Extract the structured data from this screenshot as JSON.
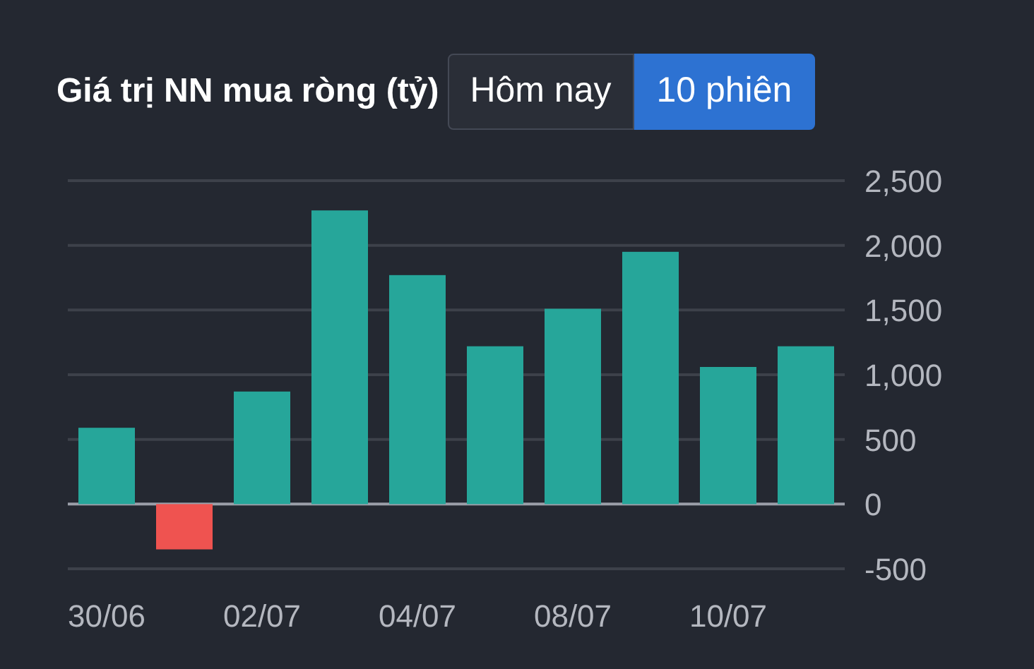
{
  "title": "Giá trị NN mua ròng (tỷ)",
  "periods": [
    {
      "label": "Hôm nay",
      "selected": false
    },
    {
      "label": "10 phiên",
      "selected": true
    }
  ],
  "chart_data": {
    "type": "bar",
    "categories": [
      "30/06",
      null,
      "02/07",
      null,
      "04/07",
      null,
      "08/07",
      null,
      "10/07",
      null
    ],
    "series": [
      {
        "color": "#26a69a",
        "values": [
          590,
          null,
          870,
          2270,
          1770,
          1220,
          1510,
          1950,
          1060,
          1220
        ]
      },
      {
        "color": "#ef5350",
        "values": [
          null,
          -350,
          null,
          null,
          null,
          null,
          null,
          null,
          null,
          null
        ]
      }
    ],
    "ylim": [
      -500,
      2500
    ],
    "grid": true,
    "yticks": [
      {
        "value": 2500,
        "label": "2,500"
      },
      {
        "value": 2000,
        "label": "2,000"
      },
      {
        "value": 1500,
        "label": "1,500"
      },
      {
        "value": 1000,
        "label": "1,000"
      },
      {
        "value": 500,
        "label": "500"
      },
      {
        "value": 0,
        "label": "0"
      },
      {
        "value": -500,
        "label": "-500"
      }
    ]
  }
}
